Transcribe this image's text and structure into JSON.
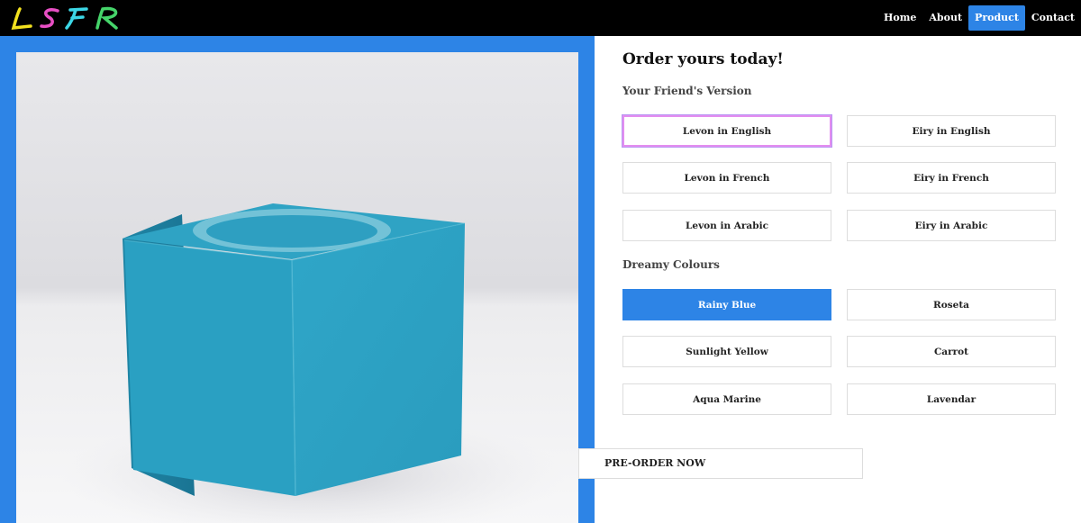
{
  "brand": {
    "logo_text": "LSFR"
  },
  "nav": {
    "items": [
      {
        "label": "Home",
        "active": false
      },
      {
        "label": "About",
        "active": false
      },
      {
        "label": "Product",
        "active": true
      },
      {
        "label": "Contact",
        "active": false
      }
    ]
  },
  "product": {
    "image": "blue-cube-candle-holder",
    "title": "Order yours today!",
    "version_label": "Your Friend's Version",
    "versions": [
      "Levon in English",
      "Eiry in English",
      "Levon in French",
      "Eiry in French",
      "Levon in Arabic",
      "Eiry in Arabic"
    ],
    "colour_label": "Dreamy Colours",
    "colours": [
      "Rainy Blue",
      "Roseta",
      "Sunlight Yellow",
      "Carrot",
      "Aqua Marine",
      "Lavendar"
    ],
    "selected_colour": "Rainy Blue",
    "preorder_label": "PRE-ORDER NOW"
  },
  "colors": {
    "accent": "#2d84e6",
    "nav_bg": "#000000",
    "cube": "#2aa0c2"
  }
}
